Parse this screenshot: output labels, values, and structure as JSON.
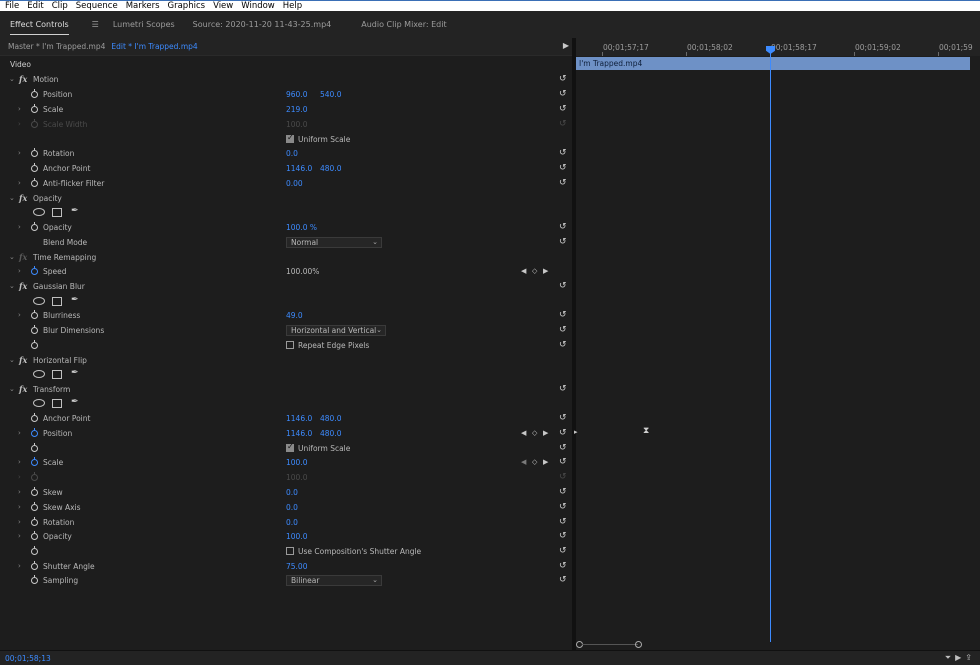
{
  "menu": [
    "File",
    "Edit",
    "Clip",
    "Sequence",
    "Markers",
    "Graphics",
    "View",
    "Window",
    "Help"
  ],
  "panel_tabs": {
    "effect_controls": "Effect Controls",
    "lumetri": "Lumetri Scopes",
    "source": "Source: 2020-11-20 11-43-25.mp4",
    "audio_mixer": "Audio Clip Mixer: Edit"
  },
  "clip_tabs": {
    "master": "Master * I'm Trapped.mp4",
    "edit": "Edit * I'm Trapped.mp4"
  },
  "video_header": "Video",
  "motion": {
    "title": "Motion",
    "position_label": "Position",
    "position_x": "960.0",
    "position_y": "540.0",
    "scale_label": "Scale",
    "scale_value": "219.0",
    "scale_width_label": "Scale Width",
    "scale_width_value": "100.0",
    "uniform_scale_label": "Uniform Scale",
    "rotation_label": "Rotation",
    "rotation_value": "0.0",
    "anchor_label": "Anchor Point",
    "anchor_x": "1146.0",
    "anchor_y": "480.0",
    "antiflicker_label": "Anti-flicker Filter",
    "antiflicker_value": "0.00"
  },
  "opacity": {
    "title": "Opacity",
    "opacity_label": "Opacity",
    "opacity_value": "100.0 %",
    "blend_label": "Blend Mode",
    "blend_value": "Normal"
  },
  "time_remap": {
    "title": "Time Remapping",
    "speed_label": "Speed",
    "speed_value": "100.00%"
  },
  "gaussian": {
    "title": "Gaussian Blur",
    "blurriness_label": "Blurriness",
    "blurriness_value": "49.0",
    "dimensions_label": "Blur Dimensions",
    "dimensions_value": "Horizontal and Vertical",
    "repeat_label": "Repeat Edge Pixels"
  },
  "hflip": {
    "title": "Horizontal Flip"
  },
  "transform": {
    "title": "Transform",
    "anchor_label": "Anchor Point",
    "anchor_x": "1146.0",
    "anchor_y": "480.0",
    "position_label": "Position",
    "position_x": "1146.0",
    "position_y": "480.0",
    "uniform_label": "Uniform Scale",
    "scale_label": "Scale",
    "scale_value": "100.0",
    "scale_width_value": "100.0",
    "skew_label": "Skew",
    "skew_value": "0.0",
    "skew_axis_label": "Skew Axis",
    "skew_axis_value": "0.0",
    "rotation_label": "Rotation",
    "rotation_value": "0.0",
    "opacity_label": "Opacity",
    "opacity_value": "100.0",
    "comp_shutter_label": "Use Composition's Shutter Angle",
    "shutter_label": "Shutter Angle",
    "shutter_value": "75.00",
    "sampling_label": "Sampling",
    "sampling_value": "Bilinear"
  },
  "timeline": {
    "timecodes": [
      "00;01;57;17",
      "00;01;58;02",
      "00;01;58;17",
      "00;01;59;02",
      "00;01;59"
    ],
    "clip_name": "I'm Trapped.mp4"
  },
  "status": {
    "timecode": "00;01;58;13"
  },
  "colors": {
    "accent": "#3d8bff",
    "clip": "#6e91c6",
    "bg": "#1d1d1d"
  }
}
